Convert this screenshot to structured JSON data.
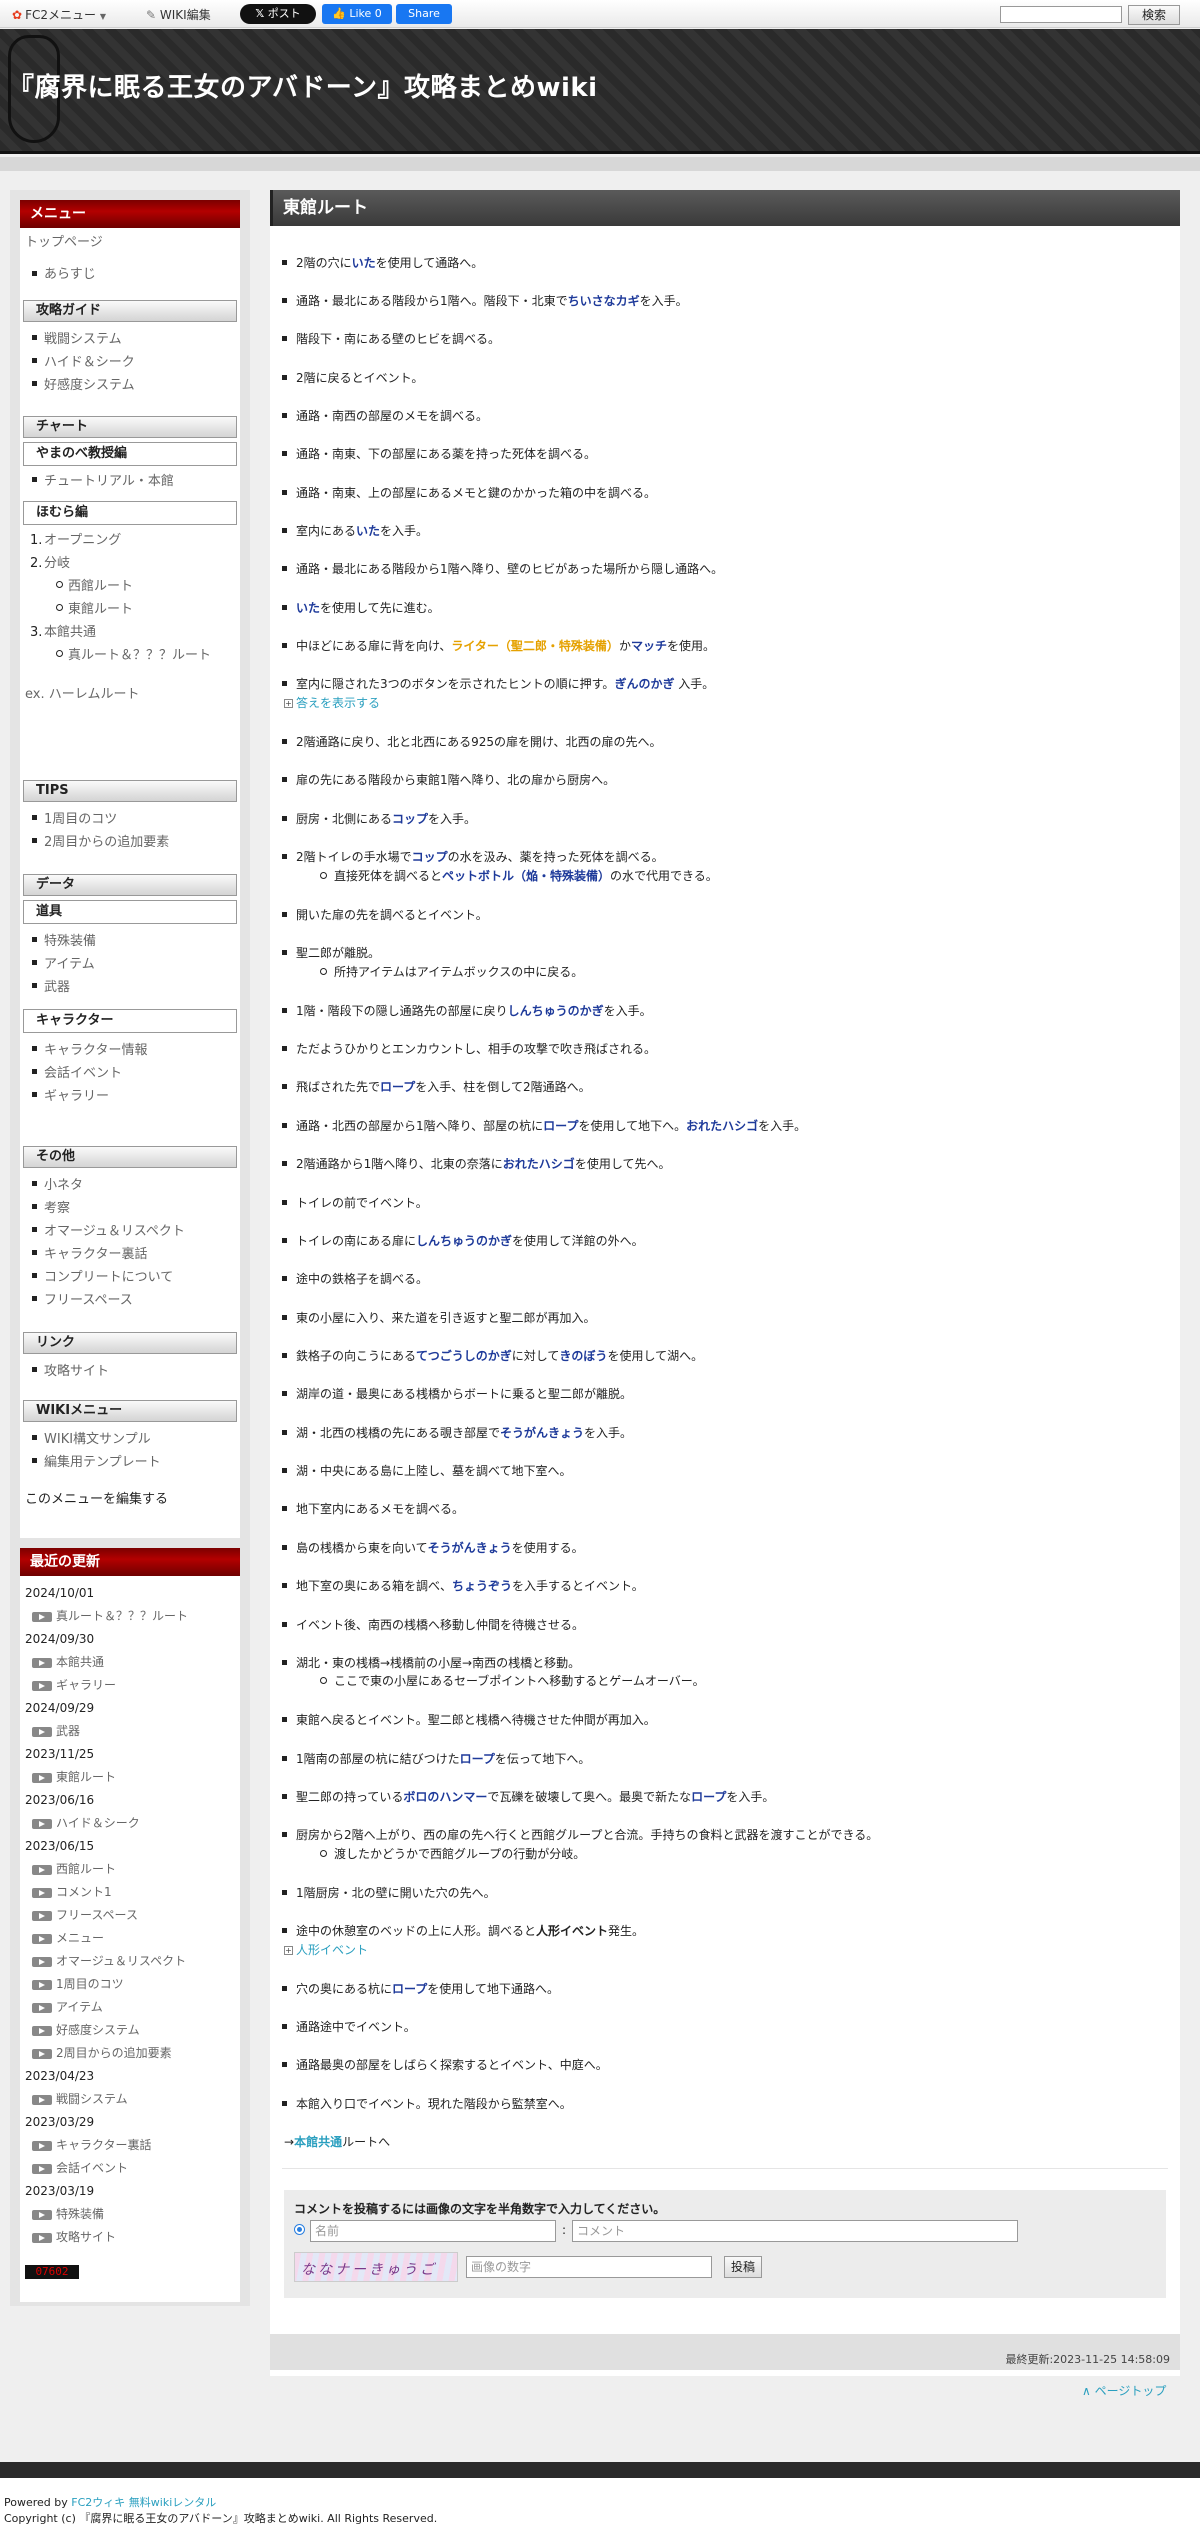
{
  "topbar": {
    "fc2_menu": "FC2メニュー",
    "wiki_edit": "WIKI編集",
    "x_post": "ポスト",
    "fb_like": "Like 0",
    "fb_share": "Share",
    "search_button": "検索"
  },
  "header": {
    "site_title": "『腐界に眠る王女のアバドーン』攻略まとめwiki"
  },
  "sidebar": {
    "menu_title": "メニュー",
    "top_page": "トップページ",
    "synopsis": "あらすじ",
    "guide_title": "攻略ガイド",
    "guide_items": [
      "戦闘システム",
      "ハイド＆シーク",
      "好感度システム"
    ],
    "chart_title": "チャート",
    "yamanobe_title": "やまのべ教授編",
    "tutorial": "チュートリアル・本館",
    "homura_title": "ほむら編",
    "homura_1": "オープニング",
    "homura_2": "分岐",
    "homura_2a": "西館ルート",
    "homura_2b": "東館ルート",
    "homura_3": "本館共通",
    "homura_3a": "真ルート＆？？？ルート",
    "ex_harlem": "ex. ハーレムルート",
    "tips_title": "TIPS",
    "tips_items": [
      "1周目のコツ",
      "2周目からの追加要素"
    ],
    "data_title": "データ",
    "tools_title": "道具",
    "tools_items": [
      "特殊装備",
      "アイテム",
      "武器"
    ],
    "character_title": "キャラクター",
    "character_items": [
      "キャラクター情報",
      "会話イベント",
      "ギャラリー"
    ],
    "other_title": "その他",
    "other_items": [
      "小ネタ",
      "考察",
      "オマージュ＆リスペクト",
      "キャラクター裏話",
      "コンプリートについて",
      "フリースペース"
    ],
    "link_title": "リンク",
    "link_items": [
      "攻略サイト"
    ],
    "wiki_menu_title": "WIKIメニュー",
    "wiki_menu_items": [
      "WIKI構文サンプル",
      "編集用テンプレート"
    ],
    "edit_menu": "このメニューを編集する",
    "recent_title": "最近の更新",
    "recent": [
      {
        "date": "2024/10/01",
        "items": [
          "真ルート＆？？？ルート"
        ]
      },
      {
        "date": "2024/09/30",
        "items": [
          "本館共通",
          "ギャラリー"
        ]
      },
      {
        "date": "2024/09/29",
        "items": [
          "武器"
        ]
      },
      {
        "date": "2023/11/25",
        "items": [
          "東館ルート"
        ]
      },
      {
        "date": "2023/06/16",
        "items": [
          "ハイド＆シーク"
        ]
      },
      {
        "date": "2023/06/15",
        "items": [
          "西館ルート",
          "コメント1",
          "フリースペース",
          "メニュー",
          "オマージュ＆リスペクト",
          "1周目のコツ",
          "アイテム",
          "好感度システム",
          "2周目からの追加要素"
        ]
      },
      {
        "date": "2023/04/23",
        "items": [
          "戦闘システム"
        ]
      },
      {
        "date": "2023/03/29",
        "items": [
          "キャラクター裏話",
          "会話イベント"
        ]
      },
      {
        "date": "2023/03/19",
        "items": [
          "特殊装備",
          "攻略サイト"
        ]
      }
    ],
    "counter": "07602"
  },
  "main": {
    "title": "東館ルート",
    "steps": {
      "s1a": "2階の穴に",
      "s1b": "いた",
      "s1c": "を使用して通路へ。",
      "s2a": "通路・最北にある階段から1階へ。階段下・北東で",
      "s2b": "ちいさなカギ",
      "s2c": "を入手。",
      "s3": "階段下・南にある壁のヒビを調べる。",
      "s4": "2階に戻るとイベント。",
      "s5": "通路・南西の部屋のメモを調べる。",
      "s6": "通路・南東、下の部屋にある薬を持った死体を調べる。",
      "s7": "通路・南東、上の部屋にあるメモと鍵のかかった箱の中を調べる。",
      "s8a": "室内にある",
      "s8b": "いた",
      "s8c": "を入手。",
      "s9": "通路・最北にある階段から1階へ降り、壁のヒビがあった場所から隠し通路へ。",
      "s10a": "いた",
      "s10b": "を使用して先に進む。",
      "s11a": "中ほどにある扉に背を向け、",
      "s11b": "ライター（聖二郎・特殊装備）",
      "s11c": "か",
      "s11d": "マッチ",
      "s11e": "を使用。",
      "s12a": "室内に隠された3つのボタンを示されたヒントの順に押す。",
      "s12b": "ぎんのかぎ",
      "s12c": " 入手。",
      "s12_toggle": "答えを表示する",
      "s13": "2階通路に戻り、北と北西にある925の扉を開け、北西の扉の先へ。",
      "s14": "扉の先にある階段から東館1階へ降り、北の扉から厨房へ。",
      "s15a": "厨房・北側にある",
      "s15b": "コップ",
      "s15c": "を入手。",
      "s16a": "2階トイレの手水場で",
      "s16b": "コップ",
      "s16c": "の水を汲み、薬を持った死体を調べる。",
      "s16sub_a": "直接死体を調べると",
      "s16sub_b": "ペットボトル（焔・特殊装備）",
      "s16sub_c": "の水で代用できる。",
      "s17": "開いた扉の先を調べるとイベント。",
      "s18": "聖二郎が離脱。",
      "s18sub": "所持アイテムはアイテムボックスの中に戻る。",
      "s19a": "1階・階段下の隠し通路先の部屋に戻り",
      "s19b": "しんちゅうのかぎ",
      "s19c": "を入手。",
      "s20": "ただようひかりとエンカウントし、相手の攻撃で吹き飛ばされる。",
      "s21a": "飛ばされた先で",
      "s21b": "ロープ",
      "s21c": "を入手、柱を倒して2階通路へ。",
      "s22a": "通路・北西の部屋から1階へ降り、部屋の杭に",
      "s22b": "ロープ",
      "s22c": "を使用して地下へ。",
      "s22d": "おれたハシゴ",
      "s22e": "を入手。",
      "s23a": "2階通路から1階へ降り、北東の奈落に",
      "s23b": "おれたハシゴ",
      "s23c": "を使用して先へ。",
      "s24": "トイレの前でイベント。",
      "s25a": "トイレの南にある扉に",
      "s25b": "しんちゅうのかぎ",
      "s25c": "を使用して洋館の外へ。",
      "s26": "途中の鉄格子を調べる。",
      "s27": "東の小屋に入り、来た道を引き返すと聖二郎が再加入。",
      "s28a": "鉄格子の向こうにある",
      "s28b": "てつごうしのかぎ",
      "s28c": "に対して",
      "s28d": "きのぼう",
      "s28e": "を使用して湖へ。",
      "s29": "湖岸の道・最奥にある桟橋からボートに乗ると聖二郎が離脱。",
      "s30a": "湖・北西の桟橋の先にある覗き部屋で",
      "s30b": "そうがんきょう",
      "s30c": "を入手。",
      "s31": "湖・中央にある島に上陸し、墓を調べて地下室へ。",
      "s32": "地下室内にあるメモを調べる。",
      "s33a": "島の桟橋から東を向いて",
      "s33b": "そうがんきょう",
      "s33c": "を使用する。",
      "s34a": "地下室の奥にある箱を調べ、",
      "s34b": "ちょうぞう",
      "s34c": "を入手するとイベント。",
      "s35": "イベント後、南西の桟橋へ移動し仲間を待機させる。",
      "s36": "湖北・東の桟橋→桟橋前の小屋→南西の桟橋と移動。",
      "s36sub": "ここで東の小屋にあるセーブポイントへ移動するとゲームオーバー。",
      "s37": "東館へ戻るとイベント。聖二郎と桟橋へ待機させた仲間が再加入。",
      "s38a": "1階南の部屋の杭に結びつけた",
      "s38b": "ロープ",
      "s38c": "を伝って地下へ。",
      "s39a": "聖二郎の持っている",
      "s39b": "ボロのハンマー",
      "s39c": "で瓦礫を破壊して奥へ。最奥で新たな",
      "s39d": "ロープ",
      "s39e": "を入手。",
      "s40": "厨房から2階へ上がり、西の扉の先へ行くと西館グループと合流。手持ちの食料と武器を渡すことができる。",
      "s40sub": "渡したかどうかで西館グループの行動が分岐。",
      "s41": "1階厨房・北の壁に開いた穴の先へ。",
      "s42a": "途中の休憩室のベッドの上に人形。調べると",
      "s42b": "人形イベント",
      "s42c": "発生。",
      "s42_toggle": "人形イベント",
      "s43a": "穴の奥にある杭に",
      "s43b": "ロープ",
      "s43c": "を使用して地下通路へ。",
      "s44": "通路途中でイベント。",
      "s45": "通路最奥の部屋をしばらく探索するとイベント、中庭へ。",
      "s46": "本館入り口でイベント。現れた階段から監禁室へ。",
      "next_arrow": "→",
      "next_link": "本館共通",
      "next_suffix": "ルートへ"
    },
    "comment": {
      "title": "コメントを投稿するには画像の文字を半角数字で入力してください。",
      "name_placeholder": "名前",
      "colon": ":",
      "comment_placeholder": "コメント",
      "captcha_placeholder": "画像の数字",
      "captcha_text": "ななナーきゅうご",
      "post_button": "投稿"
    },
    "last_modified": "最終更新:2023-11-25 14:58:09",
    "page_top": "ページトップ"
  },
  "footer": {
    "powered_by": "Powered by ",
    "powered_link": "FC2ウィキ 無料wikiレンタル",
    "copyright": "Copyright (c) 『腐界に眠る王女のアバドーン』攻略まとめwiki. All Rights Reserved."
  }
}
